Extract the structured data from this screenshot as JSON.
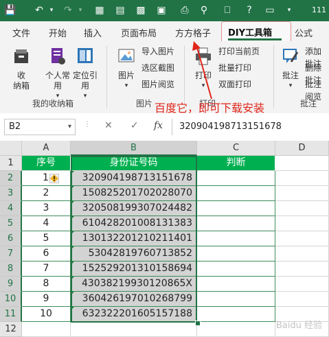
{
  "titlebar": {
    "title_partial": "111"
  },
  "tabs": [
    "文件",
    "开始",
    "插入",
    "页面布局",
    "方方格子",
    "DIY工具箱",
    "公式"
  ],
  "active_tab": "DIY工具箱",
  "ribbon": {
    "favorites": {
      "big_button": "收纳箱",
      "group_label": "我的收纳箱",
      "btn_personal": "个人常用",
      "btn_locate": "定位引用"
    },
    "images": {
      "big_button": "图片",
      "small": [
        "导入图片",
        "选区截图",
        "图片阅览"
      ],
      "group_label": "图片"
    },
    "print": {
      "big_button": "打印",
      "small": [
        "打印当前页",
        "批量打印",
        "双面打印"
      ],
      "group_label": "打印"
    },
    "comments": {
      "big_button": "批注",
      "small": [
        "添加批注",
        "删除批注",
        "批注阅览"
      ],
      "group_label": "批注"
    }
  },
  "annotation_text": "百度它，即可下载安装",
  "formula_bar": {
    "name_box": "B2",
    "cancel_icon": "✕",
    "enter_icon": "✓",
    "fx": "fx",
    "value": "320904198713151678"
  },
  "columns": [
    "A",
    "B",
    "C",
    "D"
  ],
  "rows": [
    "1",
    "2",
    "3",
    "4",
    "5",
    "6",
    "7",
    "8",
    "9",
    "10",
    "11",
    "12"
  ],
  "table": {
    "headers": [
      "序号",
      "身份证号码",
      "判断"
    ],
    "data": [
      {
        "no": "1",
        "id": "320904198713151678"
      },
      {
        "no": "2",
        "id": "150825201702028070"
      },
      {
        "no": "3",
        "id": "320508199307024482"
      },
      {
        "no": "4",
        "id": "610428201008131383"
      },
      {
        "no": "5",
        "id": "130132201210211401"
      },
      {
        "no": "6",
        "id": "53042819760713852"
      },
      {
        "no": "7",
        "id": "152529201310158694"
      },
      {
        "no": "8",
        "id": "430382199301208​65X"
      },
      {
        "no": "9",
        "id": "360426197010268799"
      },
      {
        "no": "10",
        "id": "632322201605157188"
      }
    ]
  },
  "watermark": "Baidu 经验",
  "colors": {
    "excel_green": "#217346",
    "header_green": "#00b050",
    "annotation_red": "#e0251a"
  }
}
